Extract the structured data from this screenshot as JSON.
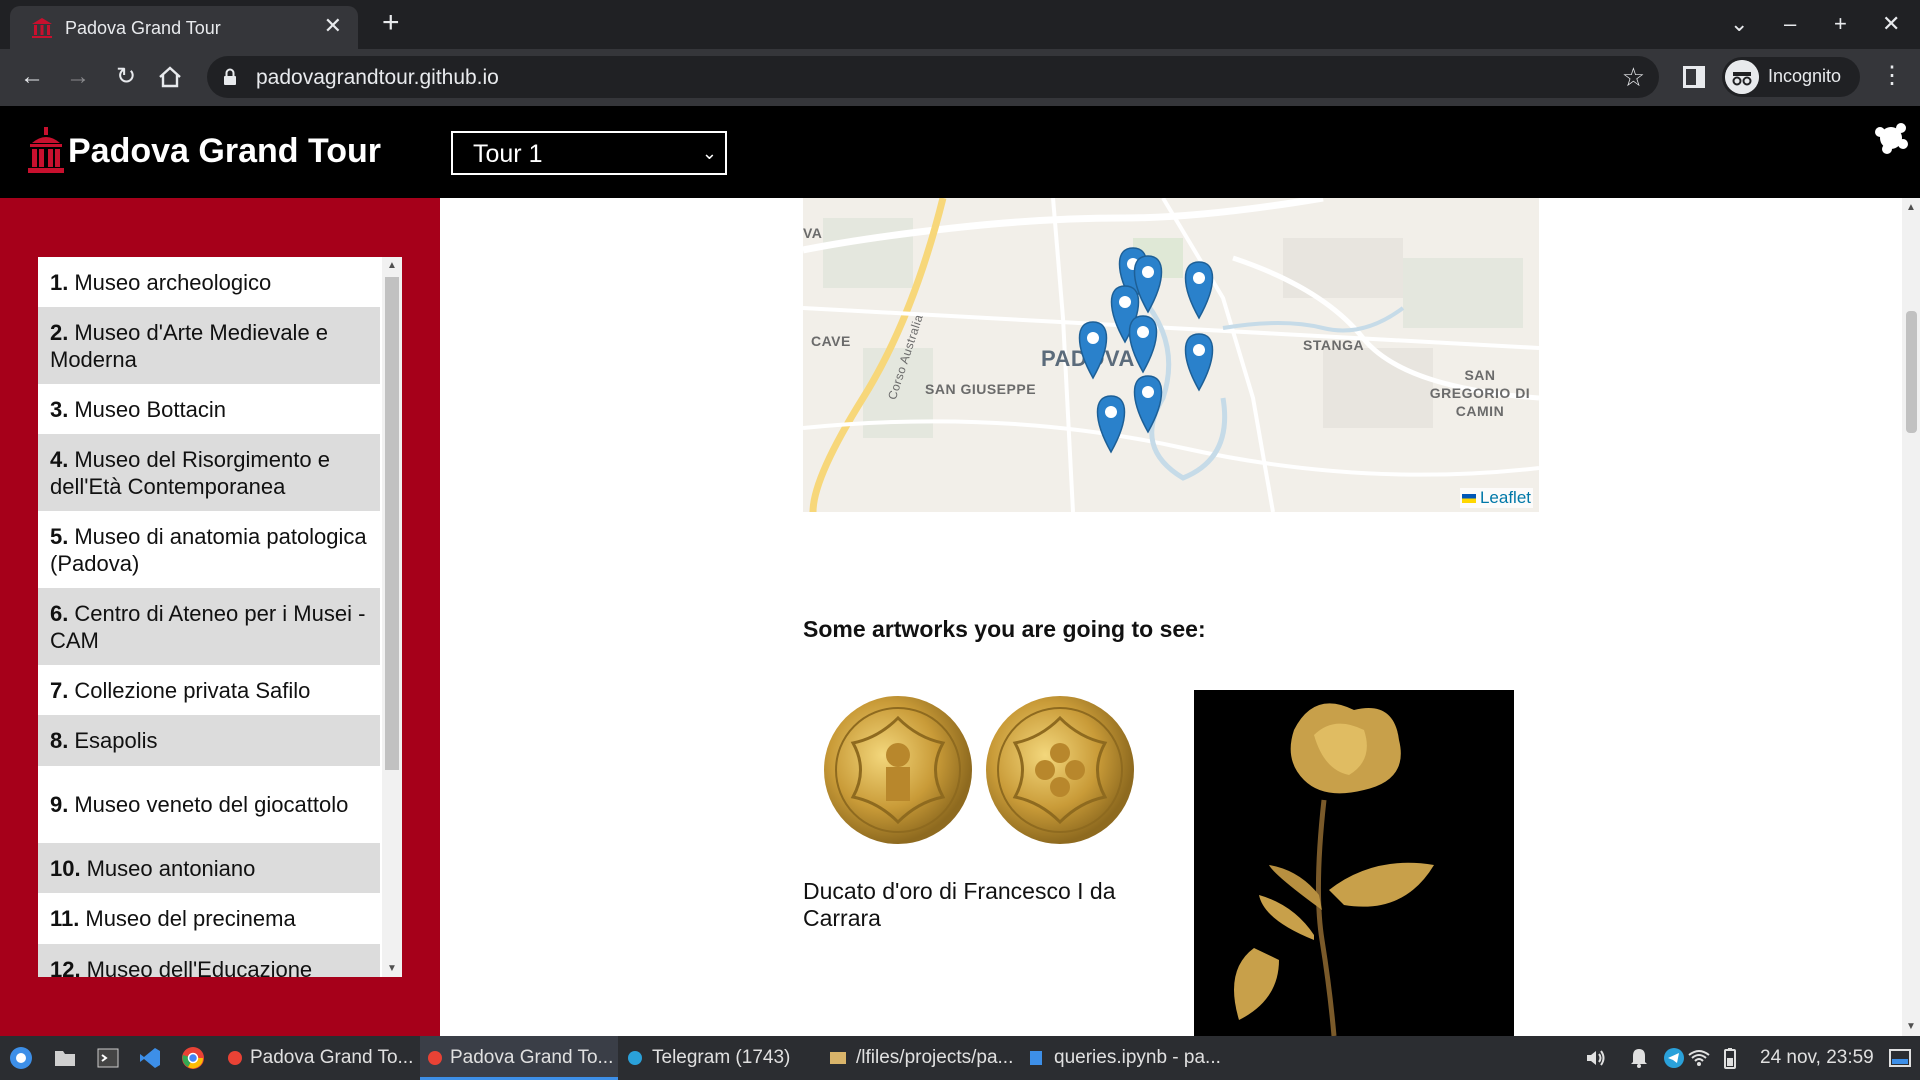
{
  "browser": {
    "tab_title": "Padova Grand Tour",
    "close_glyph": "✕",
    "newtab_glyph": "+",
    "url": "padovagrandtour.github.io",
    "profile_label": "Incognito",
    "window_controls": [
      "⌄",
      "–",
      "+",
      "✕"
    ]
  },
  "site": {
    "title": "Padova Grand Tour",
    "tour_select": {
      "selected": "Tour 1"
    },
    "icons": [
      "museum-icon",
      "theme-toggle-icon"
    ]
  },
  "museums": [
    {
      "num": "1.",
      "name": "Museo archeologico"
    },
    {
      "num": "2.",
      "name": "Museo d'Arte Medievale e Moderna"
    },
    {
      "num": "3.",
      "name": "Museo Bottacin"
    },
    {
      "num": "4.",
      "name": "Museo del Risorgimento e dell'Età Contemporanea"
    },
    {
      "num": "5.",
      "name": "Museo di anatomia patologica (Padova)"
    },
    {
      "num": "6.",
      "name": "Centro di Ateneo per i Musei - CAM"
    },
    {
      "num": "7.",
      "name": "Collezione privata Safilo"
    },
    {
      "num": "8.",
      "name": "Esapolis"
    },
    {
      "num": "9.",
      "name": "Museo veneto del giocattolo"
    },
    {
      "num": "10.",
      "name": "Museo antoniano"
    },
    {
      "num": "11.",
      "name": "Museo del precinema"
    },
    {
      "num": "12.",
      "name": "Museo dell'Educazione"
    }
  ],
  "map": {
    "labels": {
      "va": "VA",
      "cave": "CAVE",
      "corso": "Corso Australia",
      "padova": "PADOVA",
      "san_giuseppe": "SAN GIUSEPPE",
      "stanga": "STANGA",
      "san_gregorio": "SAN GREGORIO DI CAMIN"
    },
    "attribution": "Leaflet",
    "marker_count": 9
  },
  "artworks": {
    "heading": "Some artworks you are going to see:",
    "items": [
      {
        "caption": "Ducato d'oro di Francesco I da Carrara"
      }
    ]
  },
  "taskbar": {
    "tasks": [
      {
        "label": "Padova Grand To..."
      },
      {
        "label": "Padova Grand To..."
      },
      {
        "label": "Telegram (1743)"
      },
      {
        "label": "/lfiles/projects/pa..."
      },
      {
        "label": "queries.ipynb - pa..."
      }
    ],
    "clock": "24 nov, 23:59"
  }
}
